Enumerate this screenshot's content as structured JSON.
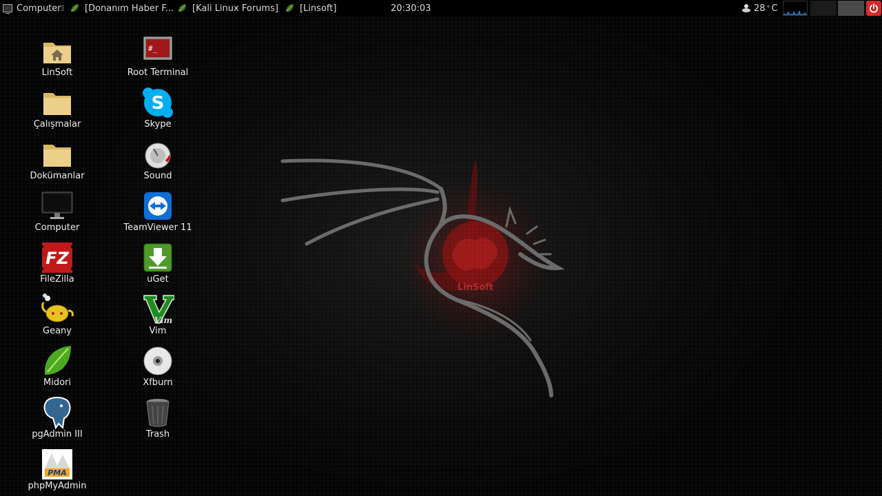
{
  "panel": {
    "menu_label": "Computer",
    "tasks": [
      "[Donanım Haber F...",
      "[Kali Linux Forums]",
      "[Linsoft]"
    ],
    "clock": "20:30:03",
    "temperature": "28",
    "temp_unit": "C"
  },
  "wallpaper": {
    "logo_text": "LinSoft"
  },
  "desktop": {
    "col1": [
      "LinSoft",
      "Çalışmalar",
      "Dokümanlar",
      "Computer",
      "FileZilla",
      "Geany",
      "Midori",
      "pgAdmin III",
      "phpMyAdmin"
    ],
    "col2": [
      "Root Terminal",
      "Skype",
      "Sound",
      "TeamViewer 11",
      "uGet",
      "Vim",
      "Xfburn",
      "Trash"
    ]
  },
  "icon_glyphs": {
    "terminal": "#_",
    "skype": "S",
    "filezilla": "FZ",
    "vim": "Vim",
    "pma": "PMA"
  },
  "colors": {
    "power": "#d62a2a",
    "accent_red": "#8b1010",
    "skype": "#00aff0",
    "teamviewer": "#0e6fd6",
    "uget": "#4e9a2a"
  }
}
